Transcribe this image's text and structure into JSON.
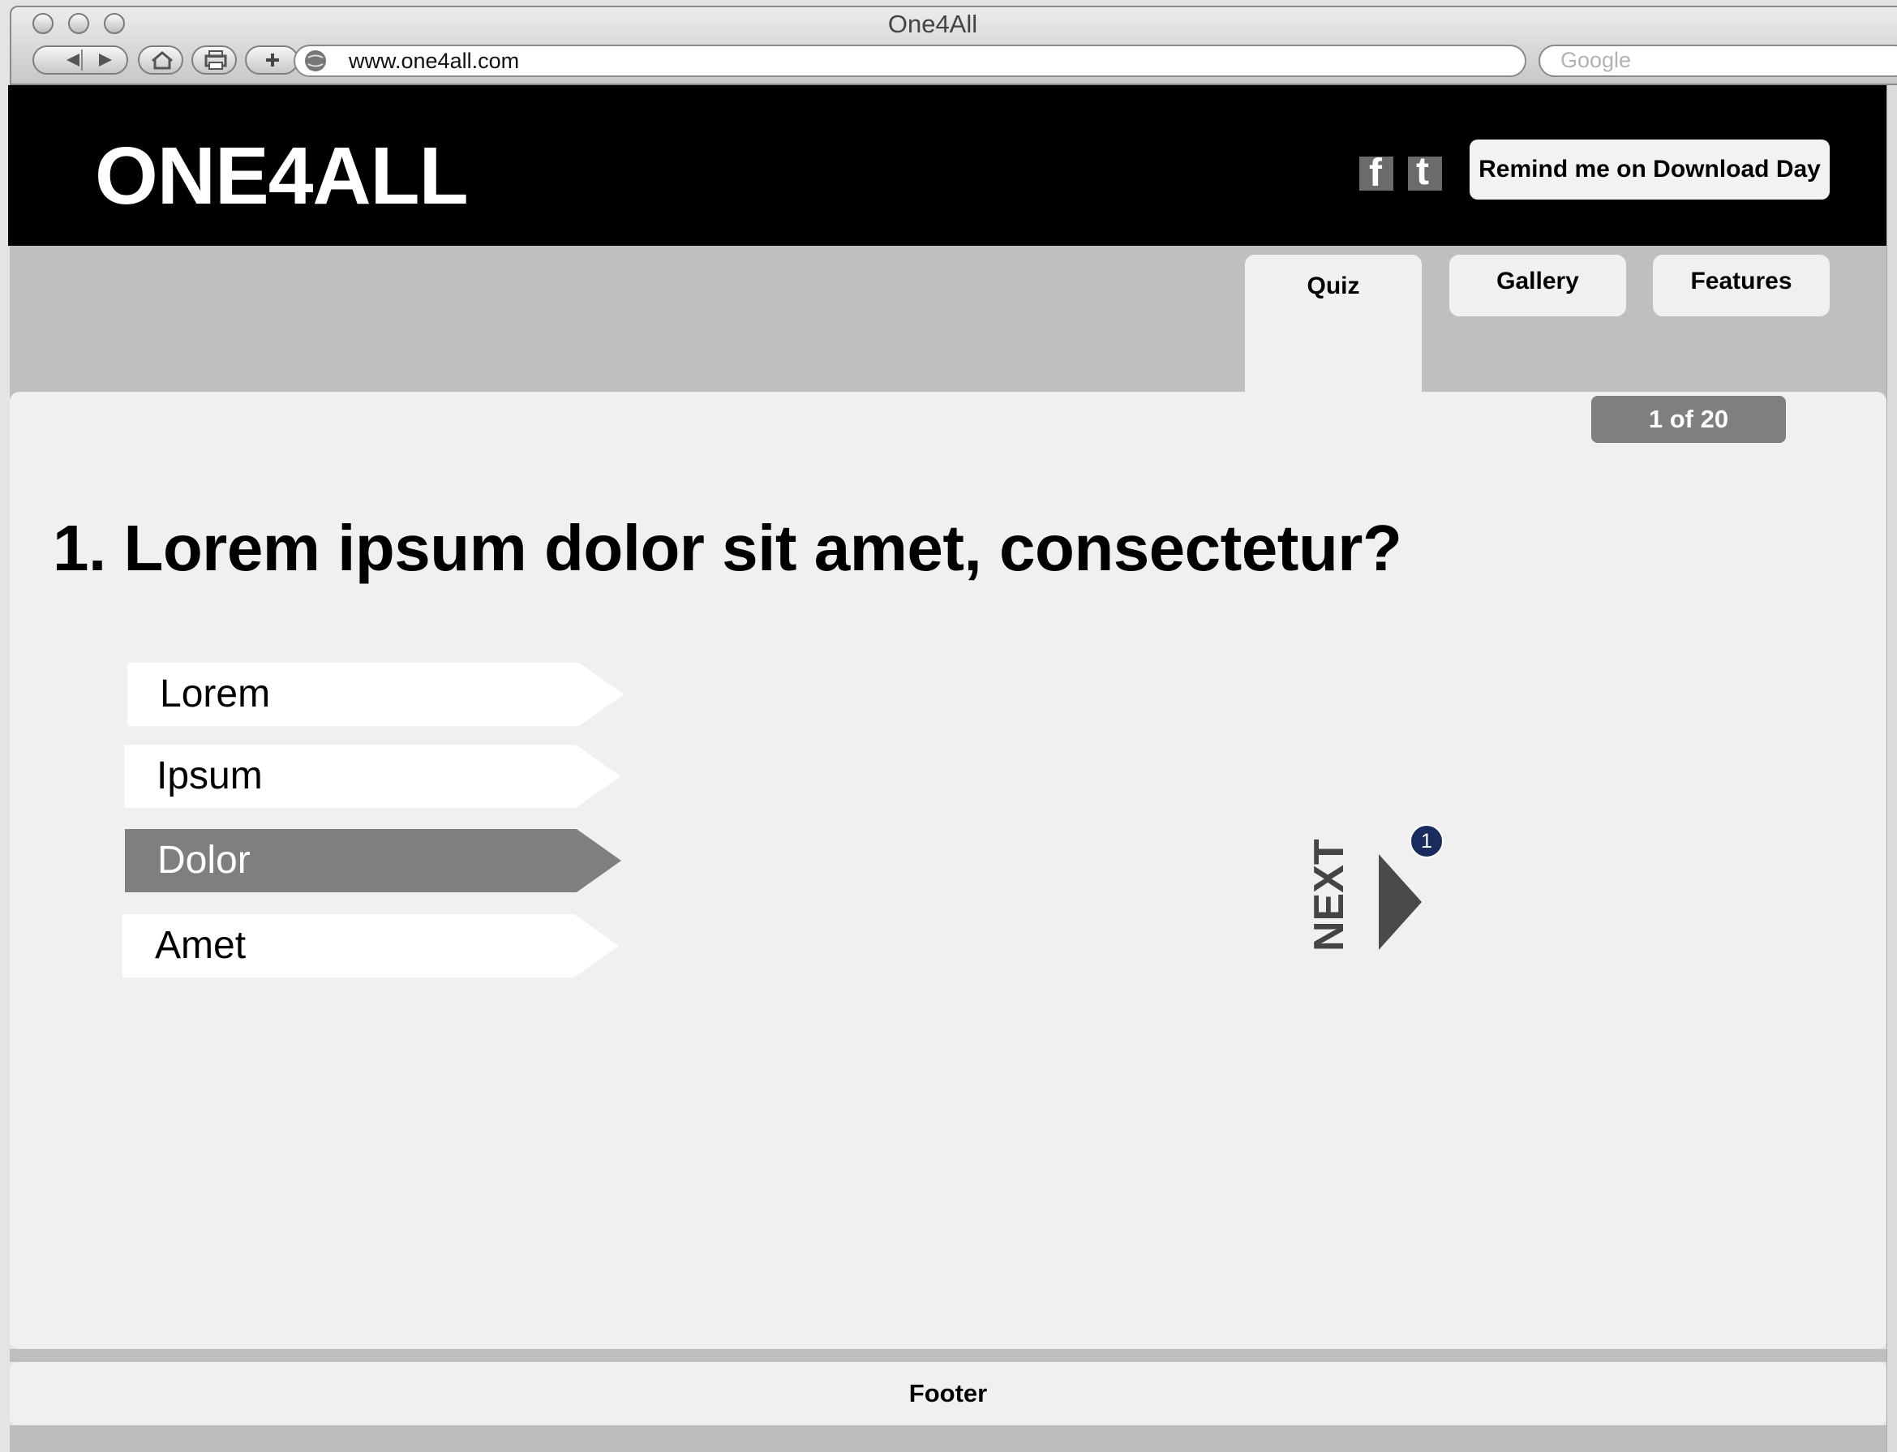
{
  "browser": {
    "window_title": "One4All",
    "url": "www.one4all.com",
    "search_placeholder": "Google"
  },
  "header": {
    "logo": "ONE4ALL",
    "facebook_glyph": "f",
    "twitter_glyph": "t",
    "remind_button": "Remind me on Download Day"
  },
  "nav": {
    "tabs": [
      {
        "label": "Quiz",
        "active": true
      },
      {
        "label": "Gallery",
        "active": false
      },
      {
        "label": "Features",
        "active": false
      }
    ]
  },
  "quiz": {
    "counter": "1 of 20",
    "question": "1. Lorem ipsum dolor sit amet, consectetur?",
    "answers": [
      {
        "label": "Lorem",
        "selected": false
      },
      {
        "label": "Ipsum",
        "selected": false
      },
      {
        "label": "Dolor",
        "selected": true
      },
      {
        "label": "Amet",
        "selected": false
      }
    ],
    "next_label": "NEXT",
    "next_badge": "1"
  },
  "footer": {
    "label": "Footer"
  },
  "colors": {
    "header_bg": "#000000",
    "selected_answer": "#7f7f7f",
    "badge": "#1a2c5e"
  }
}
